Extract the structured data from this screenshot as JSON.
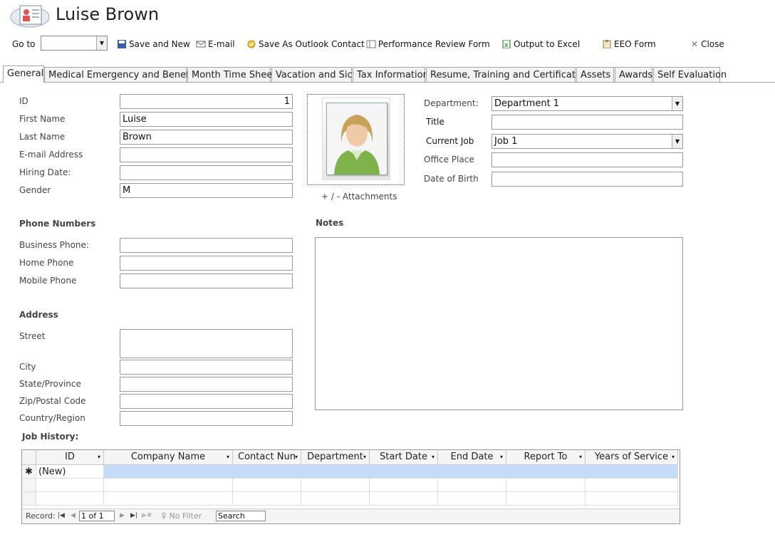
{
  "window": {
    "title": "Luise Brown"
  },
  "toolbar": {
    "goto_label": "Go to",
    "goto_value": "",
    "save_new": "Save and New",
    "email": "E-mail",
    "save_outlook": "Save As Outlook Contact",
    "perf_review": "Performance Review Form",
    "output_excel": "Output to Excel",
    "eeo": "EEO Form",
    "close": "Close"
  },
  "tabs": [
    "General",
    "Medical Emergency and Benefits",
    "Month Time Sheet",
    "Vacation and Sick",
    "Tax Information",
    "Resume, Training and Certification",
    "Assets",
    "Awards",
    "Self Evaluation"
  ],
  "general": {
    "id_label": "ID",
    "id_value": "1",
    "first_name_label": "First Name",
    "first_name_value": "Luise",
    "last_name_label": "Last Name",
    "last_name_value": "Brown",
    "email_label": "E-mail Address",
    "email_value": "",
    "hiring_label": "Hiring Date:",
    "hiring_value": "",
    "gender_label": "Gender",
    "gender_value": "M",
    "attachments_label": "+ / -  Attachments",
    "department_label": "Department:",
    "department_value": "Department 1",
    "title_label": "Title",
    "title_value": "",
    "current_job_label": "Current Job",
    "current_job_value": "Job 1",
    "office_label": "Office Place",
    "office_value": "",
    "dob_label": "Date of Birth",
    "dob_value": ""
  },
  "phones": {
    "heading": "Phone Numbers",
    "business_label": "Business Phone:",
    "business_value": "",
    "home_label": "Home Phone",
    "home_value": "",
    "mobile_label": "Mobile Phone",
    "mobile_value": ""
  },
  "address": {
    "heading": "Address",
    "street_label": "Street",
    "street_value": "",
    "city_label": "City",
    "city_value": "",
    "state_label": "State/Province",
    "state_value": "",
    "zip_label": "Zip/Postal Code",
    "zip_value": "",
    "country_label": "Country/Region",
    "country_value": ""
  },
  "notes": {
    "heading": "Notes",
    "value": ""
  },
  "job_history": {
    "heading": "Job History:",
    "columns": [
      "ID",
      "Company Name",
      "Contact Nun",
      "Department",
      "Start Date",
      "End Date",
      "Report To",
      "Years of Service"
    ],
    "new_row_marker": "✱",
    "new_row_id": "(New)",
    "nav": {
      "record_label": "Record:",
      "position": "1 of 1",
      "filter": "No Filter",
      "search": "Search"
    }
  }
}
